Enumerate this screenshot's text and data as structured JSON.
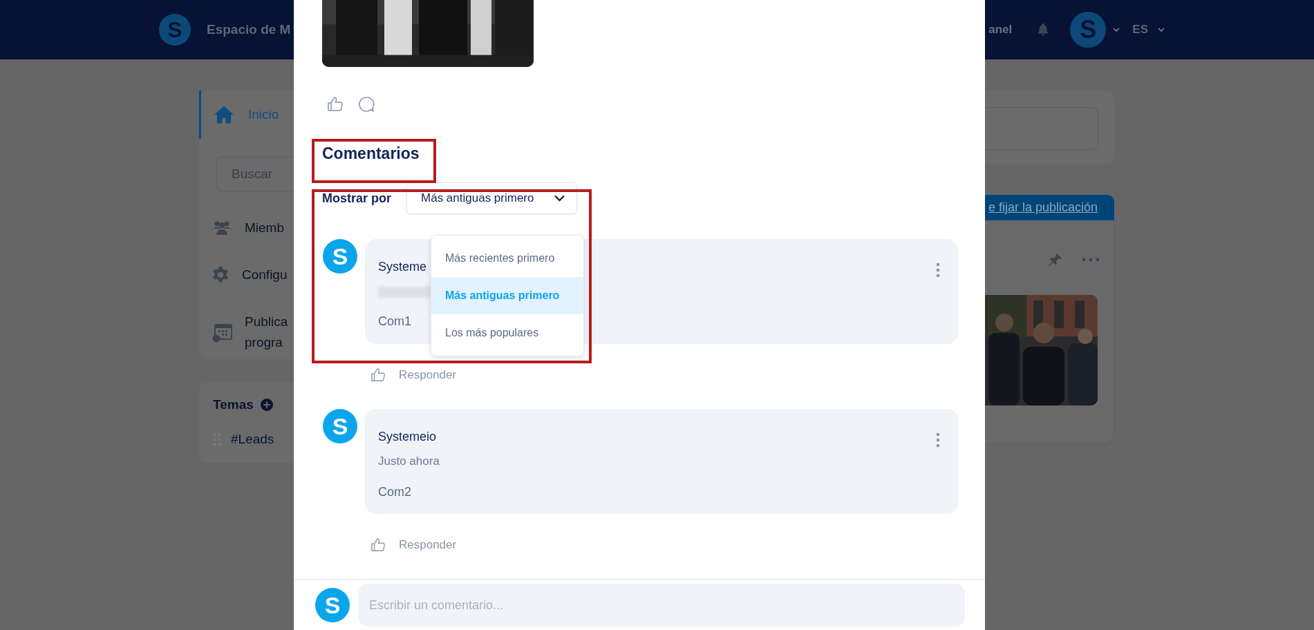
{
  "top_bar": {
    "logo": "S",
    "title": "Espacio de M",
    "panel_link": "anel",
    "avatar": "S",
    "language": "ES"
  },
  "sidebar": {
    "home": {
      "label": "Inicio",
      "selected": true
    },
    "search": {
      "placeholder": "Buscar"
    },
    "items": [
      {
        "kind": "members",
        "lines": [
          "Miemb"
        ]
      },
      {
        "kind": "settings",
        "lines": [
          "Configu"
        ]
      },
      {
        "kind": "schedule",
        "lines": [
          "Publica",
          "progra"
        ]
      }
    ]
  },
  "topics": {
    "title": "Temas",
    "items": [
      {
        "label": "#Leads"
      }
    ]
  },
  "right_panel": {
    "banner_link": "e fijar la publicación"
  },
  "modal": {
    "comments_title": "Comentarios",
    "sort": {
      "label": "Mostrar por",
      "value": "Más antiguas primero",
      "expanded": true,
      "options": [
        {
          "label": "Más recientes primero",
          "selected": false
        },
        {
          "label": "Más antiguas primero",
          "selected": true
        },
        {
          "label": "Los más populares",
          "selected": false
        }
      ]
    },
    "comments": [
      {
        "avatar": "S",
        "author": "Systeme",
        "time_redacted": true,
        "text": "Com1",
        "reply": "Responder"
      },
      {
        "avatar": "S",
        "author": "Systemeio",
        "time": "Justo ahora",
        "time_redacted": false,
        "text": "Com2",
        "reply": "Responder"
      }
    ],
    "composer": {
      "avatar": "S",
      "placeholder": "Escribir un comentario..."
    }
  }
}
